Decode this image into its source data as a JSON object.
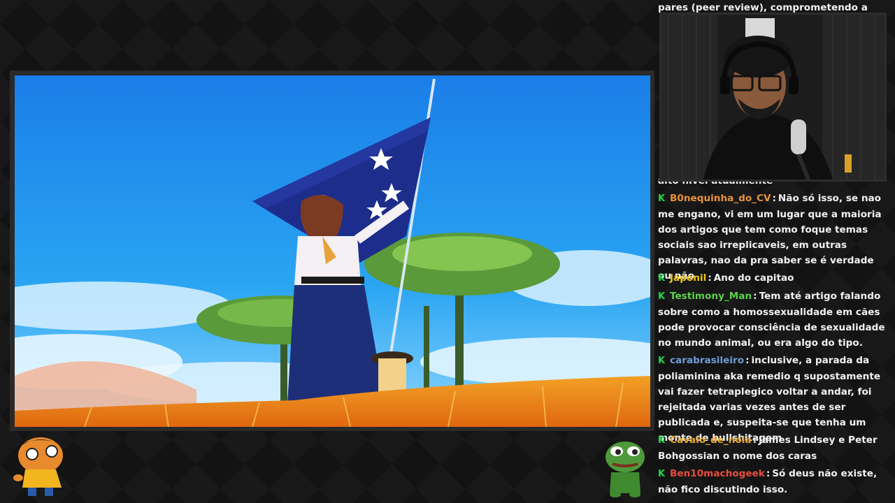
{
  "chat": {
    "partial_top": "pares (peer review), comprometendo a",
    "partial_hidden": "alto nível atualmente",
    "messages": [
      {
        "user": "B0nequinha_do_CV",
        "color": "#e8913a",
        "text": "Não só isso, se nao me engano, vi em um lugar que a maioria dos artigos que tem como foque temas sociais sao irreplicaveis, em outras palavras, nao da pra saber se é verdade ou não"
      },
      {
        "user": "Japonil",
        "color": "#f0c419",
        "text": "Ano do capitao"
      },
      {
        "user": "Testimony_Man",
        "color": "#5bd14a",
        "text": "Tem até artigo falando sobre como a homossexualidade em cães pode provocar consciência de sexualidade no mundo animal, ou era algo do tipo."
      },
      {
        "user": "carabrasileiro",
        "color": "#6e9bd9",
        "text": "inclusive, a parada da poliaminina aka remedio q supostamente vai fazer tetraplegico voltar a andar, foi rejeitada varias vezes antes de ser publicada e, suspeita-se que tenha um monte de bullshitagem"
      },
      {
        "user": "Cavalo_de_noia",
        "color": "#e8a52e",
        "text": "James Lindsey e Peter Bohgossian o nome dos caras"
      },
      {
        "user": "Ben10machogeek",
        "color": "#e84c3d",
        "text": "Só deus não existe, não fico discutindo isso."
      }
    ]
  },
  "colors": {
    "badge": "#1fd84d",
    "background": "#131313",
    "frame": "#2a2a2a"
  },
  "icons": {
    "badge": "moderator-sword-icon",
    "mascot_left": "cartoon-character-icon",
    "mascot_right": "pepe-frog-icon"
  }
}
